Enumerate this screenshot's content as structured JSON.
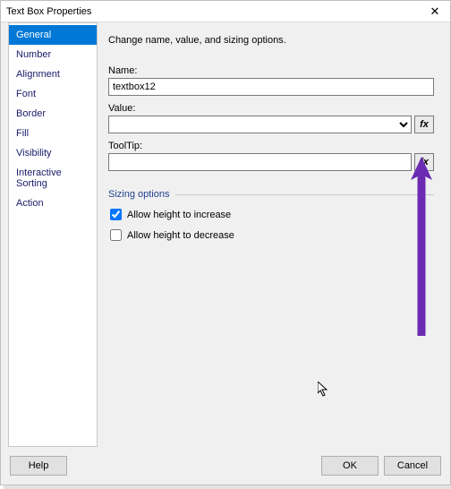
{
  "window": {
    "title": "Text Box Properties"
  },
  "sidebar": {
    "items": [
      {
        "label": "General"
      },
      {
        "label": "Number"
      },
      {
        "label": "Alignment"
      },
      {
        "label": "Font"
      },
      {
        "label": "Border"
      },
      {
        "label": "Fill"
      },
      {
        "label": "Visibility"
      },
      {
        "label": "Interactive Sorting"
      },
      {
        "label": "Action"
      }
    ],
    "active_index": 0
  },
  "main": {
    "description": "Change name, value, and sizing options.",
    "name_label": "Name:",
    "name_value": "textbox12",
    "value_label": "Value:",
    "value_value": "",
    "tooltip_label": "ToolTip:",
    "tooltip_value": "",
    "fx_glyph": "fx",
    "sizing_legend": "Sizing options",
    "allow_increase_label": "Allow height to increase",
    "allow_increase_checked": true,
    "allow_decrease_label": "Allow height to decrease",
    "allow_decrease_checked": false
  },
  "footer": {
    "help": "Help",
    "ok": "OK",
    "cancel": "Cancel"
  },
  "annotation": {
    "arrow_color": "#6b2bb3"
  }
}
